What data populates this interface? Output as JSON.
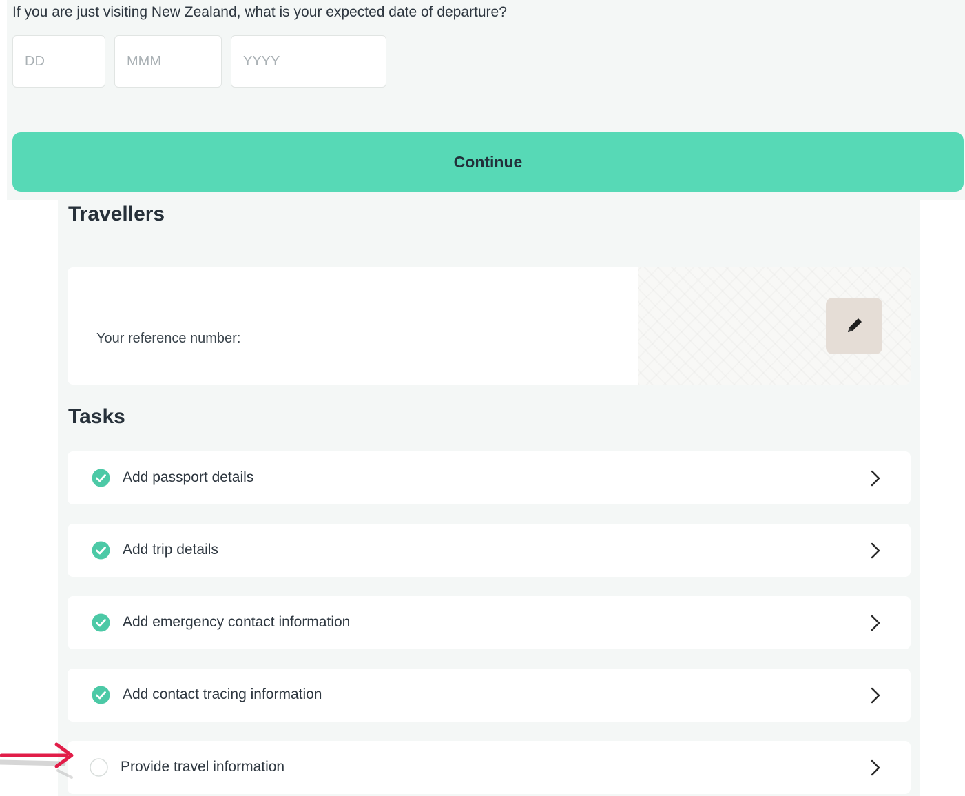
{
  "departure": {
    "question": "If you are just visiting New Zealand, what is your expected date of departure?",
    "day_placeholder": "DD",
    "month_placeholder": "MMM",
    "year_placeholder": "YYYY",
    "continue_label": "Continue"
  },
  "travellers": {
    "title": "Travellers",
    "reference_label": "Your reference number:",
    "edit_icon": "pencil-icon"
  },
  "tasks": {
    "title": "Tasks",
    "items": [
      {
        "label": "Add passport details",
        "status": "complete"
      },
      {
        "label": "Add trip details",
        "status": "complete"
      },
      {
        "label": "Add emergency contact information",
        "status": "complete"
      },
      {
        "label": "Add contact tracing information",
        "status": "complete"
      },
      {
        "label": "Provide travel information",
        "status": "incomplete"
      }
    ]
  },
  "colors": {
    "accent": "#57d9b6",
    "check": "#4cc9a6",
    "background": "#f4f7f6",
    "edit_button": "#e5ddd6",
    "annotation_arrow": "#e11d48"
  }
}
